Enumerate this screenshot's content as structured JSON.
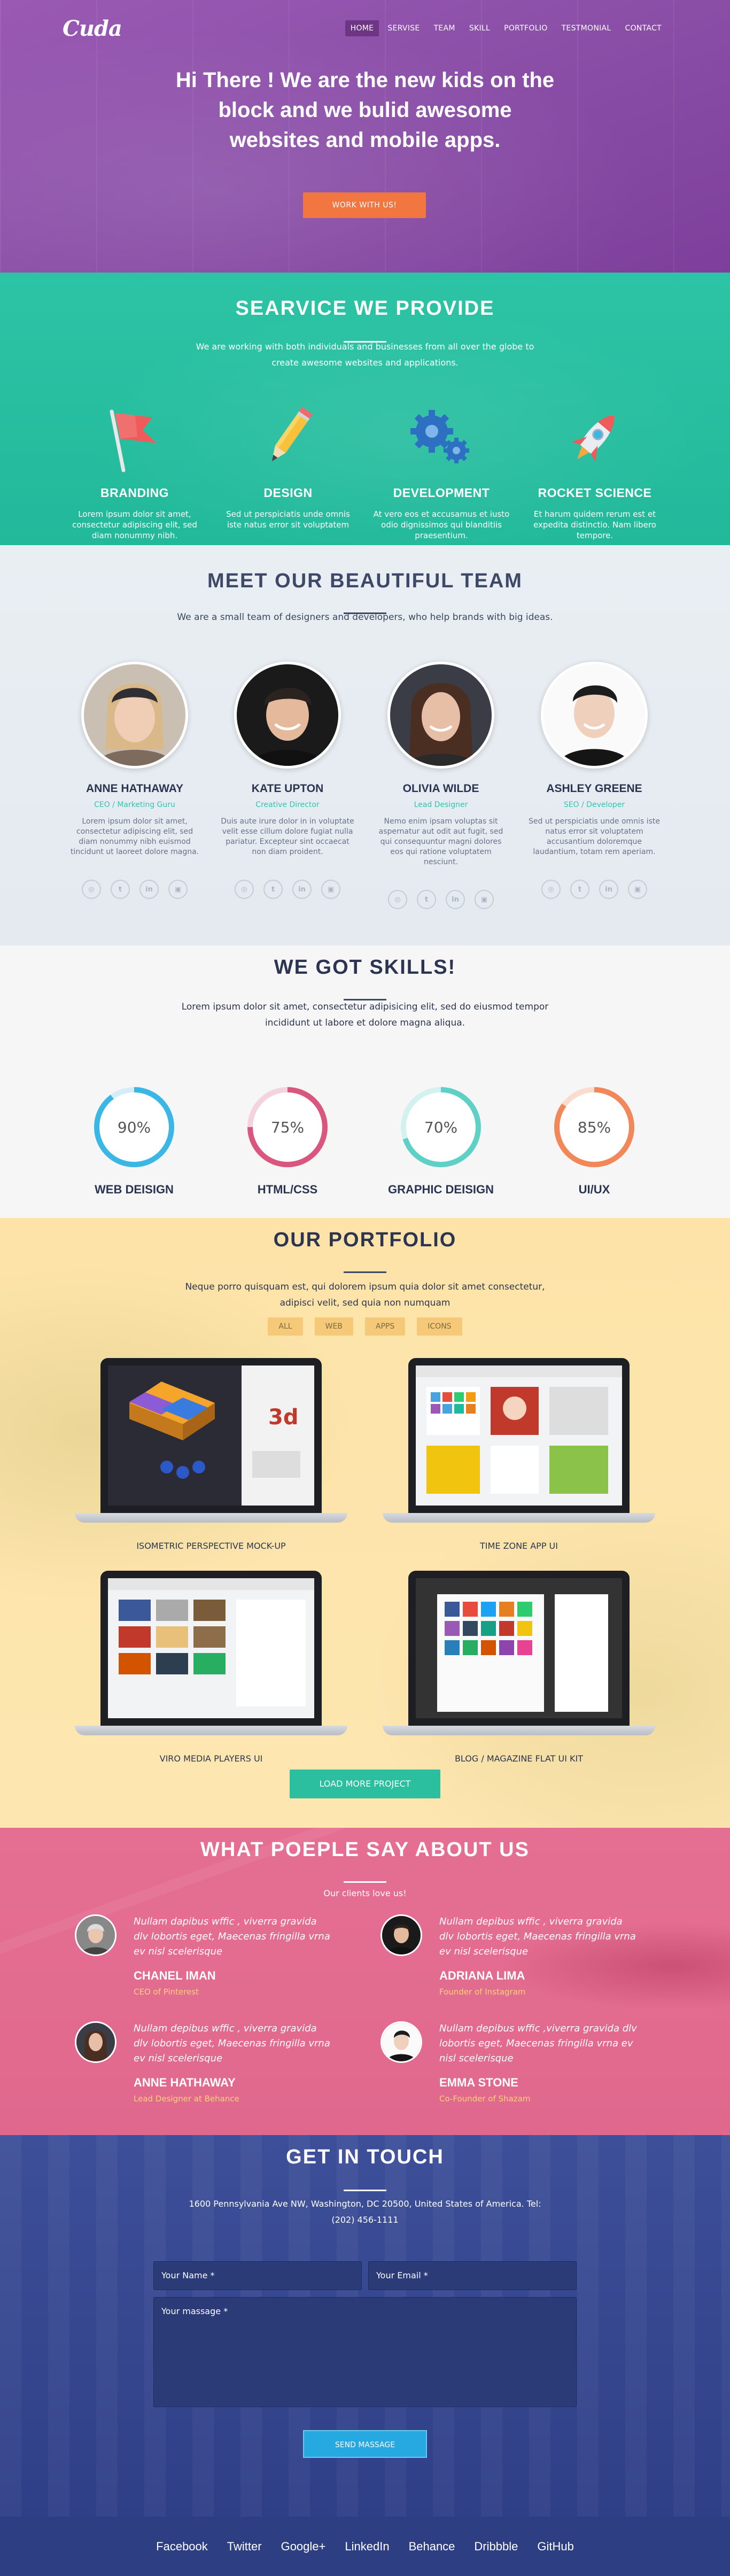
{
  "brand": {
    "logo": "Cuda",
    "accent": "#f2763f",
    "teal": "#2dc4a6",
    "purple": "#8b4fa8"
  },
  "nav": {
    "items": [
      "HOME",
      "SERVISE",
      "TEAM",
      "SKILL",
      "PORTFOLIO",
      "TESTMONIAL",
      "CONTACT"
    ],
    "active": "HOME"
  },
  "hero": {
    "line1": "Hi There ! We are the new kids on the",
    "line2": "block and we bulid awesome",
    "line3": "websites and mobile apps.",
    "cta": "WORK WITH US!"
  },
  "services": {
    "title": "SEARVICE WE PROVIDE",
    "intro": "We are working with both individuals and businesses from all over the globe to create awesome websites and applications.",
    "items": [
      {
        "icon": "flag-icon",
        "title": "BRANDING",
        "text": "Lorem ipsum dolor sit amet, consectetur adipiscing elit, sed diam nonummy nibh."
      },
      {
        "icon": "pencil-icon",
        "title": "DESIGN",
        "text": "Sed ut perspiciatis unde omnis iste natus error sit voluptatem"
      },
      {
        "icon": "gears-icon",
        "title": "DEVELOPMENT",
        "text": "At vero eos et accusamus et iusto odio dignissimos qui blanditiis praesentium."
      },
      {
        "icon": "rocket-icon",
        "title": "ROCKET SCIENCE",
        "text": "Et harum quidem rerum est et expedita distinctio. Nam libero tempore."
      }
    ]
  },
  "team": {
    "title": "MEET OUR BEAUTIFUL TEAM",
    "intro": "We are a small team of designers and developers, who help brands with big ideas.",
    "members": [
      {
        "name": "ANNE HATHAWAY",
        "role": "CEO / Marketing Guru",
        "bio": "Lorem ipsum dolor sit amet, consectetur adipiscing elit, sed diam nonummy nibh euismod tincidunt ut laoreet dolore magna."
      },
      {
        "name": "KATE UPTON",
        "role": "Creative Director",
        "bio": "Duis aute irure dolor in in voluptate velit esse cillum dolore fugiat nulla pariatur. Excepteur sint occaecat non diam proident."
      },
      {
        "name": "OLIVIA WILDE",
        "role": "Lead Designer",
        "bio": "Nemo enim ipsam voluptas sit aspernatur aut odit aut fugit, sed qui consequuntur magni dolores eos qui ratione voluptatem nesciunt."
      },
      {
        "name": "ASHLEY GREENE",
        "role": "SEO / Developer",
        "bio": "Sed ut perspiciatis unde omnis iste natus error sit voluptatem accusantium doloremque laudantium, totam rem aperiam."
      }
    ],
    "social": [
      "dribbble-icon",
      "twitter-icon",
      "linkedin-icon",
      "instagram-icon"
    ]
  },
  "skills": {
    "title": "WE GOT SKILLS!",
    "intro": "Lorem ipsum dolor sit amet, consectetur adipisicing elit, sed do eiusmod tempor incididunt ut labore et dolore magna aliqua.",
    "items": [
      {
        "name": "WEB DEISIGN",
        "value": "90%",
        "pct": 0.9,
        "color": "#3bb7e6",
        "track": "#d4eef9"
      },
      {
        "name": "HTML/CSS",
        "value": "75%",
        "pct": 0.75,
        "color": "#d9577f",
        "track": "#f5d3de"
      },
      {
        "name": "GRAPHIC DEISIGN",
        "value": "70%",
        "pct": 0.7,
        "color": "#5ed0c5",
        "track": "#d3f2ef"
      },
      {
        "name": "UI/UX",
        "value": "85%",
        "pct": 0.85,
        "color": "#f2885a",
        "track": "#f9dccd"
      }
    ]
  },
  "portfolio": {
    "title": "OUR PORTFOLIO",
    "intro": "Neque porro quisquam est, qui dolorem ipsum quia dolor sit amet consectetur, adipisci velit, sed quia non numquam",
    "filters": [
      "ALL",
      "WEB",
      "APPS",
      "ICONS"
    ],
    "projects": [
      "ISOMETRIC PERSPECTIVE MOCK-UP",
      "TIME ZONE APP UI",
      "VIRO MEDIA PLAYERS UI",
      "BLOG / MAGAZINE FLAT UI KIT"
    ],
    "load_more": "LOAD MORE PROJECT"
  },
  "testimonials": {
    "title": "WHAT POEPLE SAY ABOUT US",
    "intro": "Our clients love us!",
    "items": [
      {
        "quote": "Nullam dapibus wffic , viverra gravida dlv lobortis eget, Maecenas fringilla vrna ev nisl scelerisque",
        "name": "CHANEL IMAN",
        "role": "CEO of Pinterest"
      },
      {
        "quote": "Nullam depibus wffic , viverra gravida dlv lobortis eget, Maecenas fringilla vrna ev nisl scelerisque",
        "name": "ADRIANA LIMA",
        "role": "Founder of Instagram"
      },
      {
        "quote": "Nullam depibus wffic , viverra gravida dlv lobortis eget, Maecenas fringilla vrna ev nisl scelerisque",
        "name": "ANNE HATHAWAY",
        "role": "Lead Designer at Behance"
      },
      {
        "quote": "Nullam depibus wffic ,viverra gravida dlv lobortis eget, Maecenas fringilla vrna ev nisl scelerisque",
        "name": "EMMA STONE",
        "role": "Co-Founder of Shazam"
      }
    ]
  },
  "contact": {
    "title": "GET IN TOUCH",
    "address": "1600 Pennsylvania Ave NW, Washington, DC 20500, United States of America. Tel: (202) 456-1111",
    "name_placeholder": "Your Name *",
    "email_placeholder": "Your Email *",
    "message_placeholder": "Your massage *",
    "send": "SEND MASSAGE"
  },
  "footer": {
    "links": [
      "Facebook",
      "Twitter",
      "Google+",
      "LinkedIn",
      "Behance",
      "Dribbble",
      "GitHub"
    ]
  }
}
